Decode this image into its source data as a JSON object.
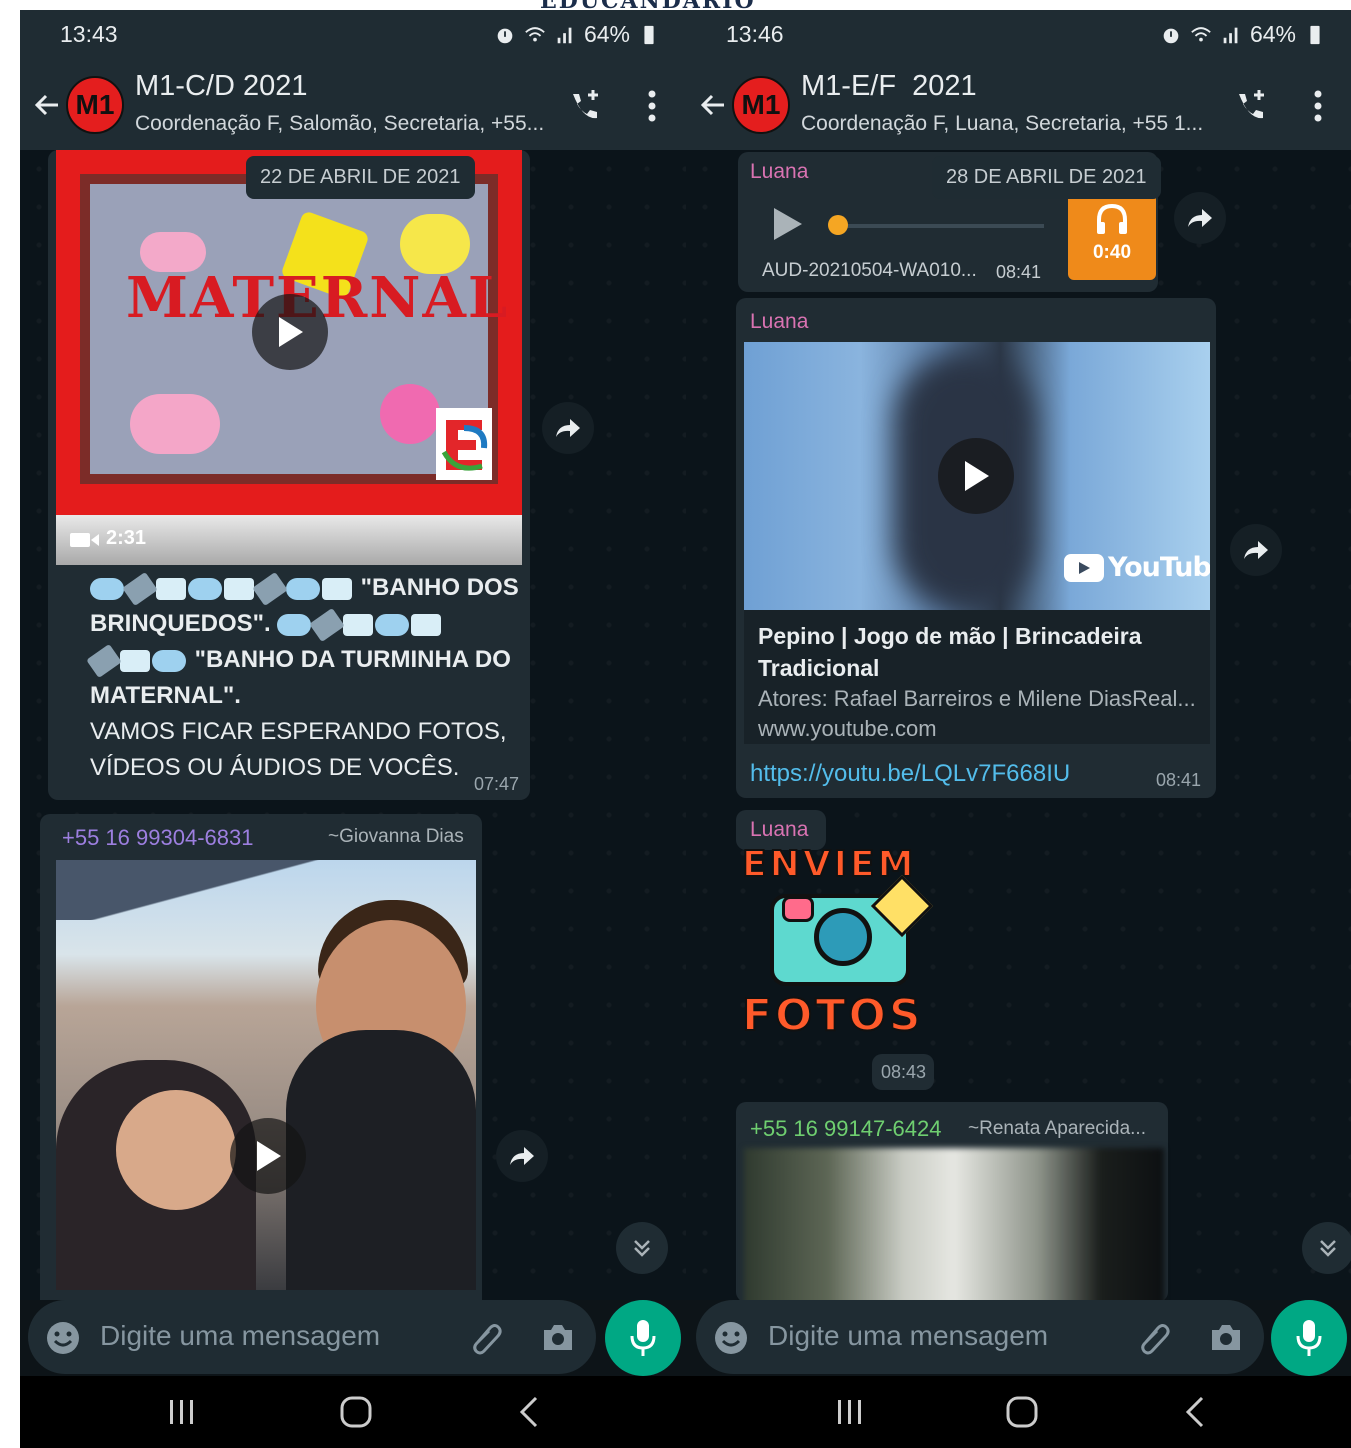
{
  "left": {
    "status": {
      "time": "13:43",
      "battery": "64%"
    },
    "header": {
      "avatar": "M1",
      "title": "M1-C/D 2021",
      "subtitle": "Coordenação F, Salomão, Secretaria, +55..."
    },
    "date_chip": "22 DE ABRIL DE 2021",
    "video_message": {
      "thumbnail_text": "MATERNAL",
      "duration": "2:31",
      "caption_bold_1": "\"BANHO DOS BRINQUEDOS\".",
      "caption_bold_2": "\"BANHO DA TURMINHA DO MATERNAL\".",
      "caption_line_1": "VAMOS FICAR ESPERANDO FOTOS,",
      "caption_line_2": "VÍDEOS OU ÁUDIOS DE VOCÊS.",
      "time": "07:47"
    },
    "photo_message": {
      "phone": "+55 16 99304-6831",
      "alias": "~Giovanna Dias"
    },
    "composer": {
      "placeholder": "Digite uma mensagem"
    }
  },
  "right": {
    "status": {
      "time": "13:46",
      "battery": "64%"
    },
    "header": {
      "avatar": "M1",
      "title": "M1-E/F  2021",
      "subtitle": "Coordenação F, Luana, Secretaria, +55 1..."
    },
    "date_chip": "28 DE ABRIL DE 2021",
    "audio_message": {
      "sender": "Luana",
      "duration": "0:40",
      "filename": "AUD-20210504-WA010...",
      "time": "08:41"
    },
    "youtube_message": {
      "sender": "Luana",
      "brand": "YouTube",
      "title": "Pepino | Jogo de mão | Brincadeira Tradicional",
      "description": "Atores: Rafael Barreiros e Milene DiasReal...",
      "site": "www.youtube.com",
      "link": "https://youtu.be/LQLv7F668IU",
      "time": "08:41"
    },
    "sticker_message": {
      "sender": "Luana",
      "sticker_top": "ENVIEM",
      "sticker_bottom": "FOTOS",
      "time": "08:43"
    },
    "photo_message": {
      "phone": "+55 16 99147-6424",
      "alias": "~Renata Aparecida..."
    },
    "composer": {
      "placeholder": "Digite uma mensagem"
    }
  },
  "colors": {
    "accent": "#00a884",
    "bubble": "#202c33",
    "header": "#1f2c33",
    "link": "#53bdeb"
  }
}
